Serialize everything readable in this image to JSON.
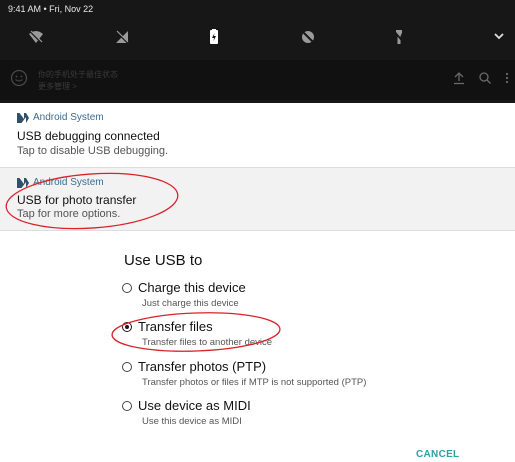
{
  "status_bar": {
    "time_date": "9:41 AM • Fri, Nov 22"
  },
  "quick_settings": {
    "icons": [
      "wifi-off-icon",
      "cellular-off-icon",
      "battery-icon",
      "location-off-icon",
      "flashlight-off-icon",
      "chevron-down-icon"
    ]
  },
  "rom_bar": {
    "line1": "你的手机处于最佳状态",
    "line2": "更多管理 >"
  },
  "notifications": [
    {
      "app": "Android System",
      "title": "USB debugging connected",
      "subtitle": "Tap to disable USB debugging."
    },
    {
      "app": "Android System",
      "title": "USB for photo transfer",
      "subtitle": "Tap for more options."
    }
  ],
  "dialog": {
    "title": "Use USB to",
    "options": [
      {
        "label": "Charge this device",
        "sub": "Just charge this device",
        "selected": false
      },
      {
        "label": "Transfer files",
        "sub": "Transfer files to another device",
        "selected": true
      },
      {
        "label": "Transfer photos (PTP)",
        "sub": "Transfer photos or files if MTP is not supported (PTP)",
        "selected": false
      },
      {
        "label": "Use device as MIDI",
        "sub": "Use this device as MIDI",
        "selected": false
      }
    ],
    "cancel_label": "CANCEL"
  },
  "colors": {
    "shade_bg": "#171717",
    "accent_teal": "#2aa3a3",
    "app_name_blue": "#3c6b8e",
    "annotation_red": "#d9232b"
  }
}
